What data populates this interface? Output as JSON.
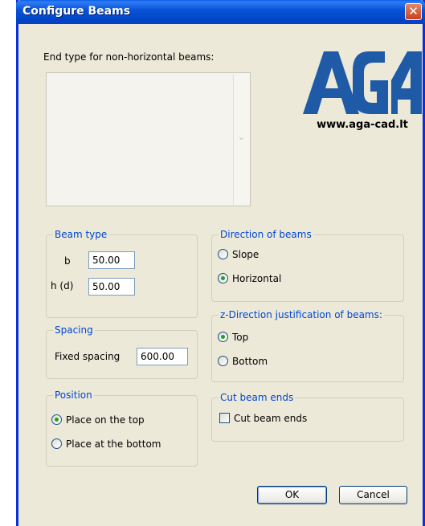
{
  "window": {
    "title": "Configure Beams",
    "close_glyph": "✕"
  },
  "end_type": {
    "label": "End type for non-horizontal beams:",
    "scroll_icon": "chevron-down-icon"
  },
  "logo": {
    "text": "AGA",
    "url": "www.aga-cad.lt",
    "color": "#1f5aa6"
  },
  "beam_type": {
    "title": "Beam type",
    "b_label": "b",
    "b_value": "50.00",
    "h_label": "h (d)",
    "h_value": "50.00"
  },
  "spacing": {
    "title": "Spacing",
    "fixed_label": "Fixed spacing",
    "fixed_value": "600.00"
  },
  "position": {
    "title": "Position",
    "options": [
      {
        "label": "Place on the top",
        "checked": true
      },
      {
        "label": "Place at the bottom",
        "checked": false
      }
    ]
  },
  "direction": {
    "title": "Direction of beams",
    "options": [
      {
        "label": "Slope",
        "checked": false
      },
      {
        "label": "Horizontal",
        "checked": true
      }
    ]
  },
  "z_direction": {
    "title": "z-Direction justification of beams:",
    "options": [
      {
        "label": "Top",
        "checked": true
      },
      {
        "label": "Bottom",
        "checked": false
      }
    ]
  },
  "cut_ends": {
    "title": "Cut beam ends",
    "checkbox_label": "Cut beam ends",
    "checked": false
  },
  "buttons": {
    "ok": "OK",
    "cancel": "Cancel"
  },
  "colors": {
    "titlebar": "#0a54d8",
    "group_title": "#0046d5",
    "radio_dot": "#21a121",
    "face": "#ece9d8"
  }
}
